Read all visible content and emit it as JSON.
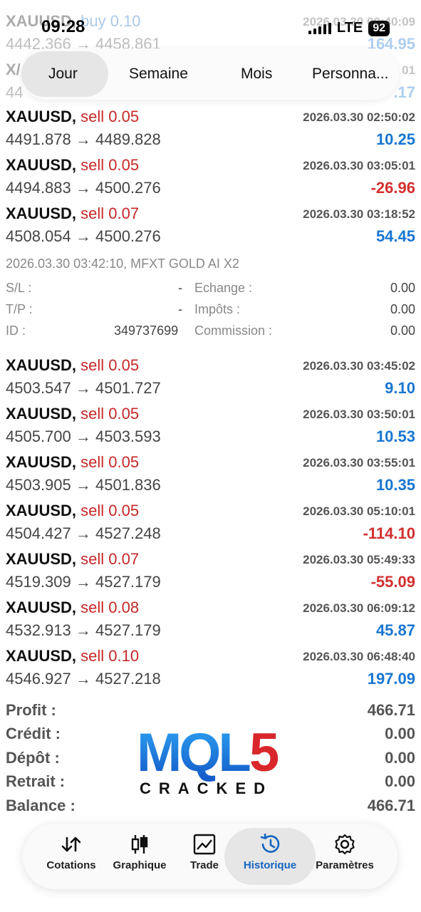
{
  "status": {
    "time": "09:28",
    "network": "LTE",
    "battery": "92"
  },
  "tabs": [
    "Jour",
    "Semaine",
    "Mois",
    "Personna..."
  ],
  "partial_rows": [
    {
      "symbol": "XAUUSD,",
      "side": "buy 0.10",
      "time": "2026.03.30 00:40:09",
      "prices": "4442.366 → 4458.861",
      "profit": "164.95"
    },
    {
      "symbol": "X/",
      "time_suffix": "01",
      "prices": "44",
      "profit": ".17"
    }
  ],
  "trades": [
    {
      "symbol": "XAUUSD,",
      "side": "sell 0.05",
      "time": "2026.03.30 02:50:02",
      "prices": "4491.878 → 4489.828",
      "profit": "10.25",
      "sign": "pos"
    },
    {
      "symbol": "XAUUSD,",
      "side": "sell 0.05",
      "time": "2026.03.30 03:05:01",
      "prices": "4494.883 → 4500.276",
      "profit": "-26.96",
      "sign": "neg"
    },
    {
      "symbol": "XAUUSD,",
      "side": "sell 0.07",
      "time": "2026.03.30 03:18:52",
      "prices": "4508.054 → 4500.276",
      "profit": "54.45",
      "sign": "pos"
    }
  ],
  "detail": {
    "header": "2026.03.30 03:42:10, MFXT GOLD AI X2",
    "sl_label": "S/L :",
    "sl_value": "-",
    "tp_label": "T/P :",
    "tp_value": "-",
    "id_label": "ID :",
    "id_value": "349737699",
    "echange_label": "Echange :",
    "echange_value": "0.00",
    "impots_label": "Impôts :",
    "impots_value": "0.00",
    "commission_label": "Commission :",
    "commission_value": "0.00"
  },
  "trades2": [
    {
      "symbol": "XAUUSD,",
      "side": "sell 0.05",
      "time": "2026.03.30 03:45:02",
      "prices": "4503.547 → 4501.727",
      "profit": "9.10",
      "sign": "pos"
    },
    {
      "symbol": "XAUUSD,",
      "side": "sell 0.05",
      "time": "2026.03.30 03:50:01",
      "prices": "4505.700 → 4503.593",
      "profit": "10.53",
      "sign": "pos"
    },
    {
      "symbol": "XAUUSD,",
      "side": "sell 0.05",
      "time": "2026.03.30 03:55:01",
      "prices": "4503.905 → 4501.836",
      "profit": "10.35",
      "sign": "pos"
    },
    {
      "symbol": "XAUUSD,",
      "side": "sell 0.05",
      "time": "2026.03.30 05:10:01",
      "prices": "4504.427 → 4527.248",
      "profit": "-114.10",
      "sign": "neg"
    },
    {
      "symbol": "XAUUSD,",
      "side": "sell 0.07",
      "time": "2026.03.30 05:49:33",
      "prices": "4519.309 → 4527.179",
      "profit": "-55.09",
      "sign": "neg"
    },
    {
      "symbol": "XAUUSD,",
      "side": "sell 0.08",
      "time": "2026.03.30 06:09:12",
      "prices": "4532.913 → 4527.179",
      "profit": "45.87",
      "sign": "pos"
    },
    {
      "symbol": "XAUUSD,",
      "side": "sell 0.10",
      "time": "2026.03.30 06:48:40",
      "prices": "4546.927 → 4527.218",
      "profit": "197.09",
      "sign": "pos"
    }
  ],
  "summary": [
    {
      "label": "Profit :",
      "value": "466.71"
    },
    {
      "label": "Crédit :",
      "value": "0.00"
    },
    {
      "label": "Dépôt :",
      "value": "0.00"
    },
    {
      "label": "Retrait :",
      "value": "0.00"
    },
    {
      "label": "Balance :",
      "value": "466.71"
    }
  ],
  "watermark": {
    "logo_text": "MQL5",
    "sub_text": "CRACKED"
  },
  "nav": [
    {
      "label": "Cotations",
      "icon": "arrows-updown-icon"
    },
    {
      "label": "Graphique",
      "icon": "candlestick-icon"
    },
    {
      "label": "Trade",
      "icon": "chart-line-icon"
    },
    {
      "label": "Historique",
      "icon": "history-icon",
      "active": true
    },
    {
      "label": "Paramètres",
      "icon": "gear-icon"
    }
  ],
  "colors": {
    "profit_positive": "#1976d2",
    "profit_negative": "#d32f2f",
    "side_sell": "#c62828",
    "side_buy": "#1565c0",
    "active_nav": "#1565c0"
  }
}
